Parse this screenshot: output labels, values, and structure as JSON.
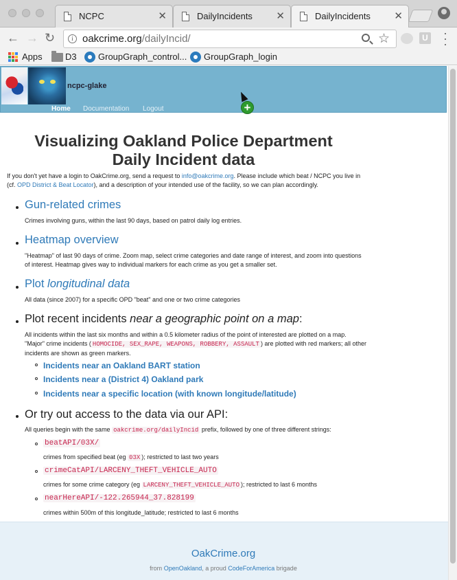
{
  "browser": {
    "tabs": [
      {
        "label": "NCPC",
        "active": false
      },
      {
        "label": "DailyIncidents",
        "active": false
      },
      {
        "label": "DailyIncidents",
        "active": true
      }
    ],
    "address": {
      "host": "oakcrime.org",
      "path": "/dailyIncid/"
    },
    "bookmarks": [
      "Apps",
      "D3",
      "GroupGraph_control...",
      "GroupGraph_login"
    ],
    "extension_letter": "U"
  },
  "site": {
    "username": "ncpc-glake",
    "nav": [
      "Home",
      "Documentation",
      "Logout"
    ],
    "add_icon": "+"
  },
  "content": {
    "title": "Visualizing Oakland Police Department Daily Incident data",
    "intro": {
      "p1": "If you don't yet have a login to OakCrime.org, send a request to ",
      "email": "info@oakcrime.org",
      "p2": ". Please include which beat / NCPC you live in (cf. ",
      "link": "OPD District & Beat Locator",
      "p3": "), and a description of your intended use of the facility, so we can plan accordingly."
    },
    "sections": [
      {
        "heading": "Gun-related crimes",
        "desc": "Crimes involving guns, within the last 90 days, based on patrol daily log entries."
      },
      {
        "heading": "Heatmap overview",
        "desc": "\"Heatmap\" of last 90 days of crime. Zoom map, select crime categories and date range of interest, and zoom into questions of interest. Heatmap gives way to individual markers for each crime as you get a smaller set."
      },
      {
        "heading_a": "Plot ",
        "heading_b": "longitudinal data",
        "desc": "All data (since 2007) for a specific OPD \"beat\" and one or two crime categories"
      },
      {
        "heading_a": "Plot recent incidents ",
        "heading_b": "near a geographic point on a map",
        "heading_c": ":",
        "desc_a": "All incidents within the last six months and within a 0.5 kilometer radius of the point of interested are plotted on a map. \"Major\" crime incidents (",
        "desc_code": "HOMOCIDE, SEX_RAPE, WEAPONS, ROBBERY, ASSAULT",
        "desc_b": ") are plotted with red markers; all other incidents are shown as green markers.",
        "links": [
          "Incidents near an Oakland BART station",
          "Incidents near a (District 4) Oakland park",
          "Incidents near a specific location (with known longitude/latitude)"
        ]
      },
      {
        "heading": "Or try out access to the data via our API:",
        "desc_a": "All queries begin with the same ",
        "desc_code": "oakcrime.org/dailyIncid",
        "desc_b": " prefix, followed by one of three different strings:",
        "endpoints": [
          {
            "path": "beatAPI/03X/",
            "d1": "crimes from specified beat (eg ",
            "code": "03X",
            "d2": "); restricted to last two years"
          },
          {
            "path": "crimeCatAPI/LARCENY_THEFT_VEHICLE_AUTO",
            "d1": "crimes for some crime category (eg ",
            "code": "LARCENY_THEFT_VEHICLE_AUTO",
            "d2": "); restricted to last 6 months"
          },
          {
            "path": "nearHereAPI/-122.265944_37.828199",
            "d1": "crimes within 500m of this longitude_latitude; restricted to last 6 months",
            "code": "",
            "d2": ""
          }
        ]
      }
    ]
  },
  "footer": {
    "brand": "OakCrime.org",
    "from": "from ",
    "org1": "OpenOakland",
    "mid": ", a proud ",
    "org2": "CodeForAmerica",
    "end": " brigade"
  },
  "colors": {
    "link": "#2f7ab8",
    "header": "#76b3cf",
    "code": "#c7254e",
    "footer_bg": "#e7f1f8"
  }
}
